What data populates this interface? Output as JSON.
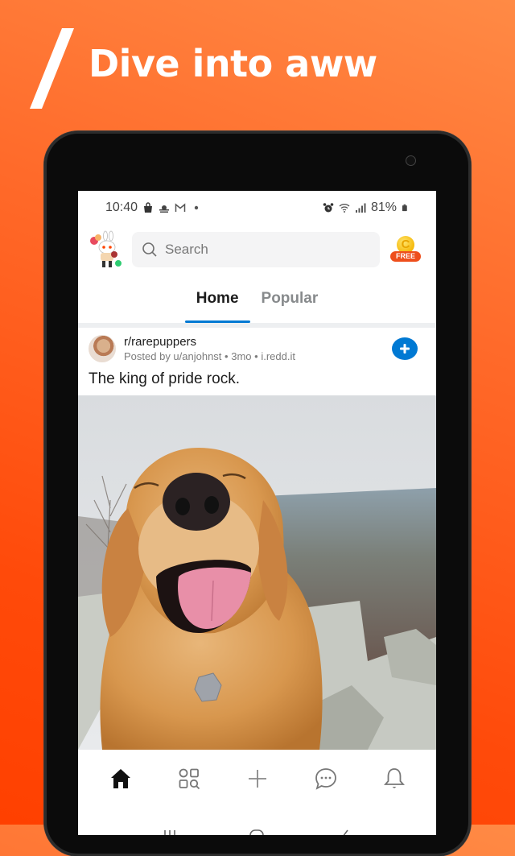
{
  "promo": {
    "headline": "Dive into aww",
    "background_colors": [
      "#FF8A45",
      "#FF4000"
    ]
  },
  "status_bar": {
    "time": "10:40",
    "left_icons": [
      "shopping-bag-icon",
      "weather-icon",
      "gmail-icon",
      "dot-icon"
    ],
    "right_icons": [
      "alarm-icon",
      "wifi-icon",
      "signal-icon",
      "battery-icon"
    ],
    "battery": "81%"
  },
  "app_bar": {
    "search_placeholder": "Search",
    "coin_letter": "C",
    "coin_badge": "FREE"
  },
  "tabs": [
    {
      "label": "Home",
      "active": true
    },
    {
      "label": "Popular",
      "active": false
    }
  ],
  "post": {
    "subreddit": "r/rarepuppers",
    "posted_by": "Posted by u/anjohnst",
    "age": "3mo",
    "domain": "i.redd.it",
    "separator": "•",
    "title": "The king of pride rock.",
    "join_label": "+"
  },
  "bottom_nav": [
    {
      "name": "home",
      "active": true
    },
    {
      "name": "discover"
    },
    {
      "name": "create"
    },
    {
      "name": "chat"
    },
    {
      "name": "notifications"
    }
  ],
  "colors": {
    "accent_blue": "#0079d3",
    "online_green": "#2ecc71",
    "free_badge": "#ee4f1c"
  }
}
